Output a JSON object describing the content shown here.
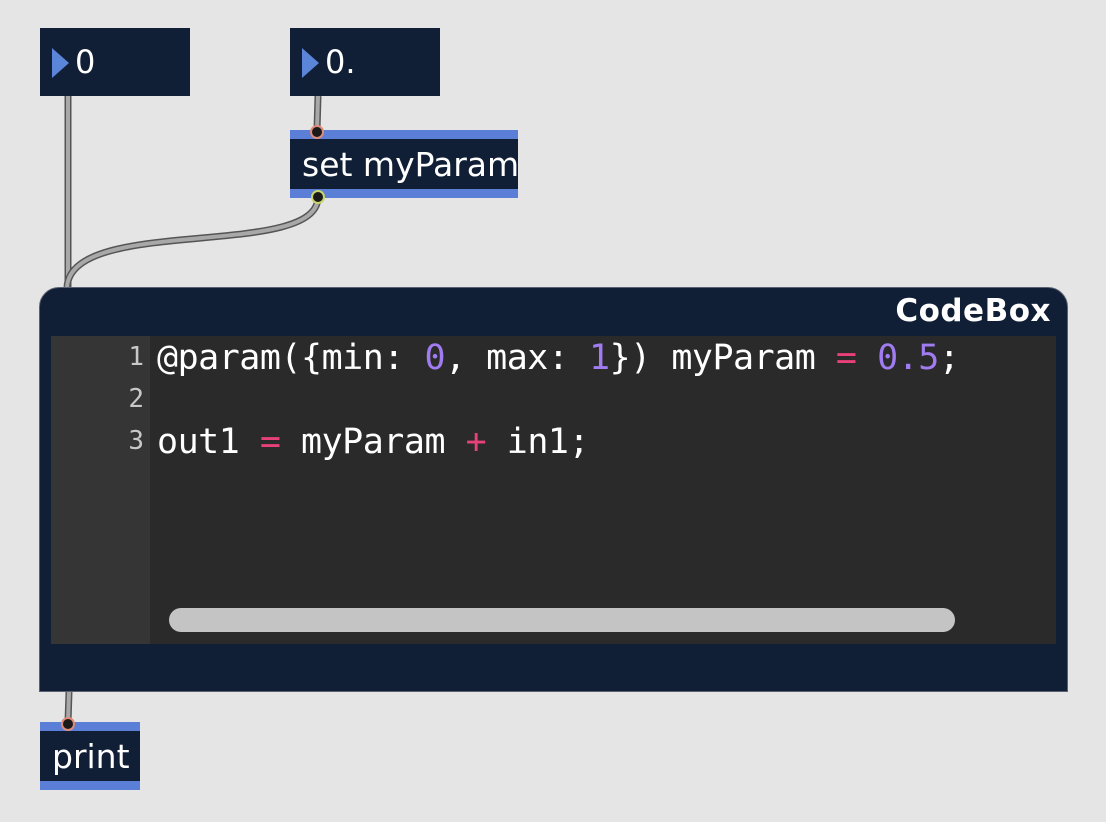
{
  "patch": {
    "number_int": {
      "value": "0"
    },
    "number_float": {
      "value": "0."
    },
    "message_set": {
      "label": "set myParam"
    },
    "codebox": {
      "title": "CodeBox",
      "lines": [
        {
          "number": "1",
          "tokens": [
            {
              "text": "@param({min: ",
              "kind": "plain"
            },
            {
              "text": "0",
              "kind": "num"
            },
            {
              "text": ", max: ",
              "kind": "plain"
            },
            {
              "text": "1",
              "kind": "num"
            },
            {
              "text": "}) myParam ",
              "kind": "plain"
            },
            {
              "text": "=",
              "kind": "op"
            },
            {
              "text": " ",
              "kind": "plain"
            },
            {
              "text": "0.5",
              "kind": "num"
            },
            {
              "text": ";",
              "kind": "plain"
            }
          ]
        },
        {
          "number": "2",
          "tokens": []
        },
        {
          "number": "3",
          "tokens": [
            {
              "text": "out1 ",
              "kind": "plain"
            },
            {
              "text": "=",
              "kind": "op"
            },
            {
              "text": " myParam ",
              "kind": "plain"
            },
            {
              "text": "+",
              "kind": "op"
            },
            {
              "text": " in1;",
              "kind": "plain"
            }
          ]
        }
      ]
    },
    "print_object": {
      "label": "print"
    }
  },
  "colors": {
    "canvas_bg": "#e5e5e5",
    "object_bg": "#101f35",
    "accent_blue": "#5b7fd6",
    "code_number": "#a07cf0",
    "code_operator": "#e8407a",
    "patch_cord": "#9a9a9a"
  }
}
